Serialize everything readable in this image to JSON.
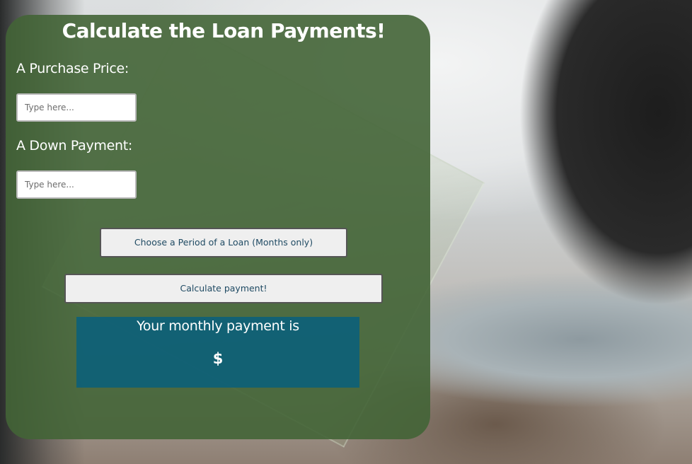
{
  "page": {
    "title": "Calculate the Loan Payments!"
  },
  "form": {
    "purchase_price_label": "A Purchase Price:",
    "purchase_price_placeholder": "Type here...",
    "purchase_price_value": "",
    "down_payment_label": "A Down Payment:",
    "down_payment_placeholder": "Type here...",
    "down_payment_value": "",
    "period_button_label": "Choose a Period of a Loan (Months only)",
    "calculate_button_label": "Calculate payment!"
  },
  "result": {
    "text": "Your monthly payment is",
    "value": "$"
  },
  "colors": {
    "card_bg": "#426436",
    "result_bg": "#085f7d",
    "button_text": "#1f4a63"
  }
}
